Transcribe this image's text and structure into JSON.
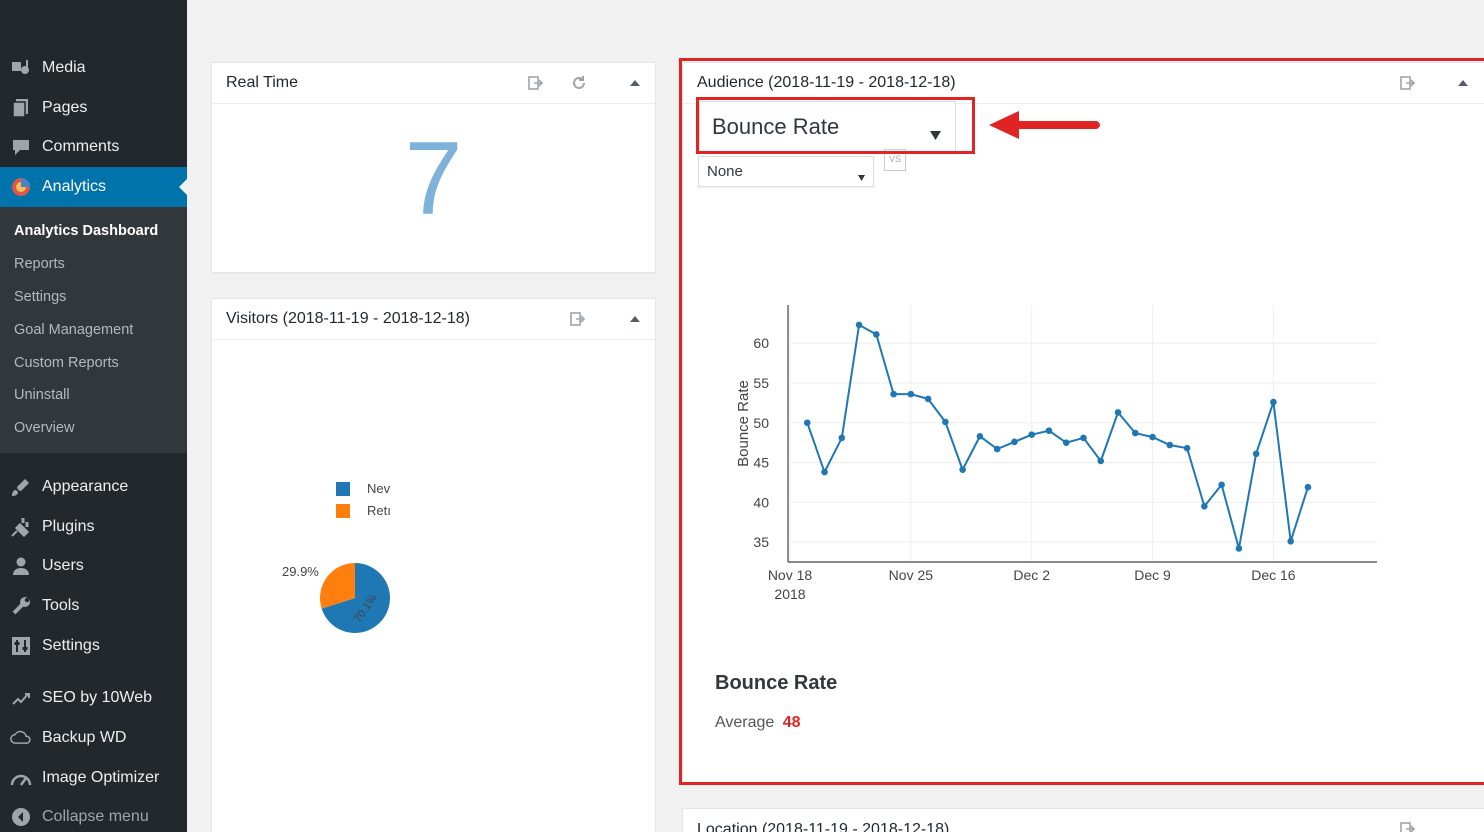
{
  "sidebar": {
    "items": [
      {
        "label": "Media",
        "icon": "media-icon"
      },
      {
        "label": "Pages",
        "icon": "pages-icon"
      },
      {
        "label": "Comments",
        "icon": "comments-icon"
      },
      {
        "label": "Analytics",
        "icon": "analytics-icon",
        "active": true
      },
      {
        "label": "Appearance",
        "icon": "appearance-icon"
      },
      {
        "label": "Plugins",
        "icon": "plugins-icon"
      },
      {
        "label": "Users",
        "icon": "users-icon"
      },
      {
        "label": "Tools",
        "icon": "tools-icon"
      },
      {
        "label": "Settings",
        "icon": "settings-icon"
      },
      {
        "label": "SEO by 10Web",
        "icon": "seo-icon"
      },
      {
        "label": "Backup WD",
        "icon": "cloud-icon"
      },
      {
        "label": "Image Optimizer",
        "icon": "gauge-icon"
      },
      {
        "label": "Collapse menu",
        "icon": "collapse-icon"
      }
    ],
    "submenu": [
      {
        "label": "Analytics Dashboard",
        "current": true
      },
      {
        "label": "Reports"
      },
      {
        "label": "Settings"
      },
      {
        "label": "Goal Management"
      },
      {
        "label": "Custom Reports"
      },
      {
        "label": "Uninstall"
      },
      {
        "label": "Overview"
      }
    ]
  },
  "realtime": {
    "title": "Real Time",
    "count": "7"
  },
  "visitors": {
    "title": "Visitors (2018-11-19 - 2018-12-18)",
    "legend": [
      {
        "label": "Nev",
        "color": "#1f77b4"
      },
      {
        "label": "Retı",
        "color": "#ff7f0e"
      }
    ],
    "pie": {
      "new_pct": 70.1,
      "returning_pct": 29.9,
      "new_label": "70.1%",
      "returning_label": "29.9%"
    }
  },
  "audience": {
    "title": "Audience (2018-11-19 - 2018-12-18)",
    "metric_select": "Bounce Rate",
    "compare_select": "None",
    "vs_label": "VS",
    "summary_title": "Bounce Rate",
    "average_label": "Average",
    "average_value": "48"
  },
  "location": {
    "title": "Location (2018-11-19 - 2018-12-18)"
  },
  "colors": {
    "accent": "#0073aa",
    "highlight": "#e02424",
    "series": "#1f77b4",
    "returning": "#ff7f0e"
  },
  "chart_data": {
    "type": "line",
    "ylabel": "Bounce Rate",
    "xlabel": "",
    "x": [
      "2018-11-19",
      "2018-11-20",
      "2018-11-21",
      "2018-11-22",
      "2018-11-23",
      "2018-11-24",
      "2018-11-25",
      "2018-11-26",
      "2018-11-27",
      "2018-11-28",
      "2018-11-29",
      "2018-11-30",
      "2018-12-01",
      "2018-12-02",
      "2018-12-03",
      "2018-12-04",
      "2018-12-05",
      "2018-12-06",
      "2018-12-07",
      "2018-12-08",
      "2018-12-09",
      "2018-12-10",
      "2018-12-11",
      "2018-12-12",
      "2018-12-13",
      "2018-12-14",
      "2018-12-15",
      "2018-12-16",
      "2018-12-17",
      "2018-12-18"
    ],
    "series": [
      {
        "values": [
          50.0,
          43.8,
          48.1,
          62.3,
          61.1,
          53.6,
          53.6,
          53.0,
          50.1,
          44.1,
          48.3,
          46.7,
          47.6,
          48.5,
          49.0,
          47.5,
          48.1,
          45.2,
          51.3,
          48.7,
          48.2,
          47.2,
          46.8,
          39.5,
          42.2,
          34.2,
          46.1,
          52.6,
          35.1,
          41.9
        ]
      }
    ],
    "xticks": [
      {
        "date": "2018-11-18",
        "label": "Nov 18",
        "sublabel": "2018"
      },
      {
        "date": "2018-11-25",
        "label": "Nov 25"
      },
      {
        "date": "2018-12-02",
        "label": "Dec 2"
      },
      {
        "date": "2018-12-09",
        "label": "Dec 9"
      },
      {
        "date": "2018-12-16",
        "label": "Dec 16"
      }
    ],
    "yticks": [
      35,
      40,
      45,
      50,
      55,
      60
    ],
    "xlim": [
      "2018-11-18",
      "2018-12-22"
    ],
    "ylim": [
      32.5,
      64.8
    ],
    "grid": true
  }
}
